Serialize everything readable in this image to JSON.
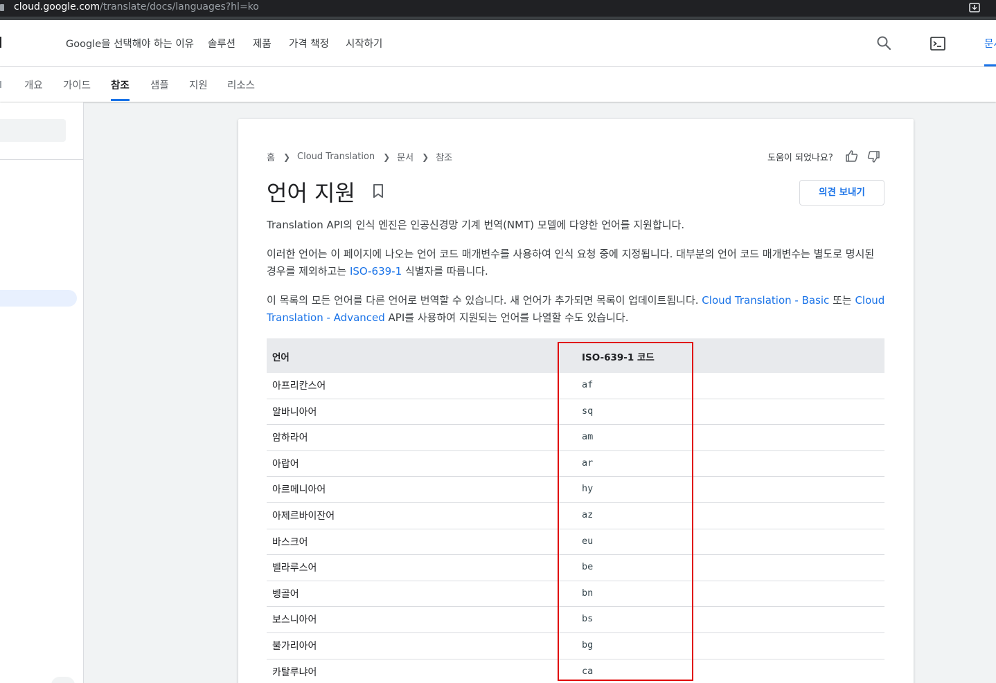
{
  "browser": {
    "url_host": "cloud.google.com",
    "url_path": "/translate/docs/languages?hl=ko"
  },
  "topnav": {
    "items": [
      "Google을 선택해야 하는 이유",
      "솔루션",
      "제품",
      "가격 책정",
      "시작하기"
    ],
    "docs_label": "문서"
  },
  "subnav": {
    "tabs": [
      "개요",
      "가이드",
      "참조",
      "샘플",
      "지원",
      "리소스"
    ],
    "active_tab": "참조"
  },
  "breadcrumb": [
    "홈",
    "Cloud Translation",
    "문서",
    "참조"
  ],
  "helpful_label": "도움이 되었나요?",
  "page_title": "언어 지원",
  "feedback_button": "의견 보내기",
  "paragraphs": {
    "p1": "Translation API의 인식 엔진은 인공신경망 기계 번역(NMT) 모델에 다양한 언어를 지원합니다.",
    "p2_before": "이러한 언어는 이 페이지에 나오는 언어 코드 매개변수를 사용하여 인식 요청 중에 지정됩니다. 대부분의 언어 코드 매개변수는 별도로 명시된 경우를 제외하고는 ",
    "p2_link": "ISO-639-1",
    "p2_after": " 식별자를 따릅니다.",
    "p3_before": "이 목록의 모든 언어를 다른 언어로 번역할 수 있습니다. 새 언어가 추가되면 목록이 업데이트됩니다. ",
    "p3_link1": "Cloud Translation - Basic",
    "p3_mid": " 또는 ",
    "p3_link2": "Cloud Translation - Advanced",
    "p3_after": " API를 사용하여 지원되는 언어를 나열할 수도 있습니다."
  },
  "table": {
    "headers": [
      "언어",
      "ISO-639-1 코드"
    ],
    "rows": [
      {
        "lang": "아프리칸스어",
        "code": "af"
      },
      {
        "lang": "알바니아어",
        "code": "sq"
      },
      {
        "lang": "암하라어",
        "code": "am"
      },
      {
        "lang": "아랍어",
        "code": "ar"
      },
      {
        "lang": "아르메니아어",
        "code": "hy"
      },
      {
        "lang": "아제르바이잔어",
        "code": "az"
      },
      {
        "lang": "바스크어",
        "code": "eu"
      },
      {
        "lang": "벨라루스어",
        "code": "be"
      },
      {
        "lang": "벵골어",
        "code": "bn"
      },
      {
        "lang": "보스니아어",
        "code": "bs"
      },
      {
        "lang": "불가리아어",
        "code": "bg"
      },
      {
        "lang": "카탈루냐어",
        "code": "ca"
      }
    ]
  },
  "colors": {
    "accent": "#1a73e8",
    "highlight_box": "#e00000"
  }
}
